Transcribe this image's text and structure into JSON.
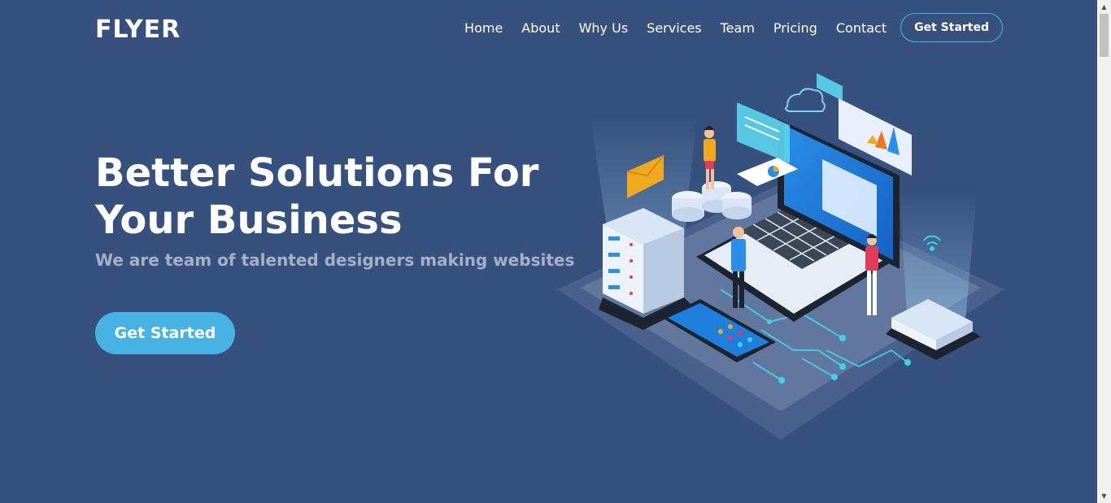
{
  "brand": {
    "logo": "FLYER"
  },
  "nav": {
    "items": [
      "Home",
      "About",
      "Why Us",
      "Services",
      "Team",
      "Pricing",
      "Contact"
    ],
    "cta": "Get Started"
  },
  "hero": {
    "title_line1": "Better Solutions For",
    "title_line2": "Your Business",
    "subtitle": "We are team of talented designers making websites",
    "button": "Get Started"
  },
  "colors": {
    "background": "#37517e",
    "accent": "#47b2e4"
  }
}
